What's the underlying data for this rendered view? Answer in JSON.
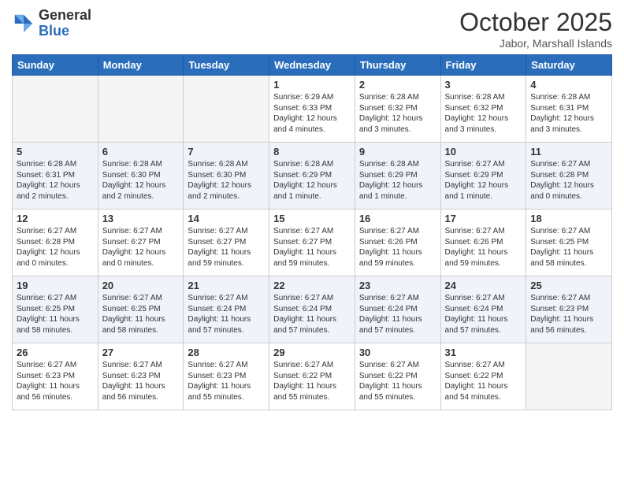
{
  "header": {
    "logo_general": "General",
    "logo_blue": "Blue",
    "title": "October 2025",
    "location": "Jabor, Marshall Islands"
  },
  "weekdays": [
    "Sunday",
    "Monday",
    "Tuesday",
    "Wednesday",
    "Thursday",
    "Friday",
    "Saturday"
  ],
  "weeks": [
    [
      {
        "day": "",
        "content": ""
      },
      {
        "day": "",
        "content": ""
      },
      {
        "day": "",
        "content": ""
      },
      {
        "day": "1",
        "content": "Sunrise: 6:29 AM\nSunset: 6:33 PM\nDaylight: 12 hours\nand 4 minutes."
      },
      {
        "day": "2",
        "content": "Sunrise: 6:28 AM\nSunset: 6:32 PM\nDaylight: 12 hours\nand 3 minutes."
      },
      {
        "day": "3",
        "content": "Sunrise: 6:28 AM\nSunset: 6:32 PM\nDaylight: 12 hours\nand 3 minutes."
      },
      {
        "day": "4",
        "content": "Sunrise: 6:28 AM\nSunset: 6:31 PM\nDaylight: 12 hours\nand 3 minutes."
      }
    ],
    [
      {
        "day": "5",
        "content": "Sunrise: 6:28 AM\nSunset: 6:31 PM\nDaylight: 12 hours\nand 2 minutes."
      },
      {
        "day": "6",
        "content": "Sunrise: 6:28 AM\nSunset: 6:30 PM\nDaylight: 12 hours\nand 2 minutes."
      },
      {
        "day": "7",
        "content": "Sunrise: 6:28 AM\nSunset: 6:30 PM\nDaylight: 12 hours\nand 2 minutes."
      },
      {
        "day": "8",
        "content": "Sunrise: 6:28 AM\nSunset: 6:29 PM\nDaylight: 12 hours\nand 1 minute."
      },
      {
        "day": "9",
        "content": "Sunrise: 6:28 AM\nSunset: 6:29 PM\nDaylight: 12 hours\nand 1 minute."
      },
      {
        "day": "10",
        "content": "Sunrise: 6:27 AM\nSunset: 6:29 PM\nDaylight: 12 hours\nand 1 minute."
      },
      {
        "day": "11",
        "content": "Sunrise: 6:27 AM\nSunset: 6:28 PM\nDaylight: 12 hours\nand 0 minutes."
      }
    ],
    [
      {
        "day": "12",
        "content": "Sunrise: 6:27 AM\nSunset: 6:28 PM\nDaylight: 12 hours\nand 0 minutes."
      },
      {
        "day": "13",
        "content": "Sunrise: 6:27 AM\nSunset: 6:27 PM\nDaylight: 12 hours\nand 0 minutes."
      },
      {
        "day": "14",
        "content": "Sunrise: 6:27 AM\nSunset: 6:27 PM\nDaylight: 11 hours\nand 59 minutes."
      },
      {
        "day": "15",
        "content": "Sunrise: 6:27 AM\nSunset: 6:27 PM\nDaylight: 11 hours\nand 59 minutes."
      },
      {
        "day": "16",
        "content": "Sunrise: 6:27 AM\nSunset: 6:26 PM\nDaylight: 11 hours\nand 59 minutes."
      },
      {
        "day": "17",
        "content": "Sunrise: 6:27 AM\nSunset: 6:26 PM\nDaylight: 11 hours\nand 59 minutes."
      },
      {
        "day": "18",
        "content": "Sunrise: 6:27 AM\nSunset: 6:25 PM\nDaylight: 11 hours\nand 58 minutes."
      }
    ],
    [
      {
        "day": "19",
        "content": "Sunrise: 6:27 AM\nSunset: 6:25 PM\nDaylight: 11 hours\nand 58 minutes."
      },
      {
        "day": "20",
        "content": "Sunrise: 6:27 AM\nSunset: 6:25 PM\nDaylight: 11 hours\nand 58 minutes."
      },
      {
        "day": "21",
        "content": "Sunrise: 6:27 AM\nSunset: 6:24 PM\nDaylight: 11 hours\nand 57 minutes."
      },
      {
        "day": "22",
        "content": "Sunrise: 6:27 AM\nSunset: 6:24 PM\nDaylight: 11 hours\nand 57 minutes."
      },
      {
        "day": "23",
        "content": "Sunrise: 6:27 AM\nSunset: 6:24 PM\nDaylight: 11 hours\nand 57 minutes."
      },
      {
        "day": "24",
        "content": "Sunrise: 6:27 AM\nSunset: 6:24 PM\nDaylight: 11 hours\nand 57 minutes."
      },
      {
        "day": "25",
        "content": "Sunrise: 6:27 AM\nSunset: 6:23 PM\nDaylight: 11 hours\nand 56 minutes."
      }
    ],
    [
      {
        "day": "26",
        "content": "Sunrise: 6:27 AM\nSunset: 6:23 PM\nDaylight: 11 hours\nand 56 minutes."
      },
      {
        "day": "27",
        "content": "Sunrise: 6:27 AM\nSunset: 6:23 PM\nDaylight: 11 hours\nand 56 minutes."
      },
      {
        "day": "28",
        "content": "Sunrise: 6:27 AM\nSunset: 6:23 PM\nDaylight: 11 hours\nand 55 minutes."
      },
      {
        "day": "29",
        "content": "Sunrise: 6:27 AM\nSunset: 6:22 PM\nDaylight: 11 hours\nand 55 minutes."
      },
      {
        "day": "30",
        "content": "Sunrise: 6:27 AM\nSunset: 6:22 PM\nDaylight: 11 hours\nand 55 minutes."
      },
      {
        "day": "31",
        "content": "Sunrise: 6:27 AM\nSunset: 6:22 PM\nDaylight: 11 hours\nand 54 minutes."
      },
      {
        "day": "",
        "content": ""
      }
    ]
  ]
}
